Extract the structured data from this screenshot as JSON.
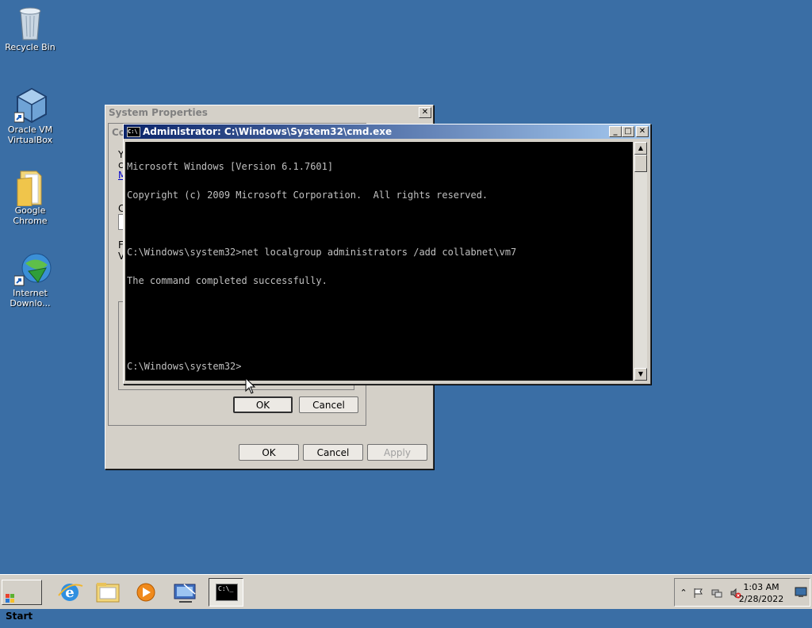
{
  "desktop": {
    "icons": [
      {
        "label": "Recycle Bin",
        "icon": "recycle-bin-icon"
      },
      {
        "label": "Oracle VM VirtualBox",
        "icon": "virtualbox-icon"
      },
      {
        "label": "Google Chrome",
        "icon": "folder-icon"
      },
      {
        "label": "Internet Downlo...",
        "icon": "internet-download-manager-icon"
      }
    ]
  },
  "system_properties": {
    "title": "System Properties",
    "close": "✕",
    "tab_fragment": "Co",
    "left_fragments": [
      "Y",
      "c",
      "M",
      "C",
      "F",
      "V"
    ],
    "ok_label": "OK",
    "cancel_label": "Cancel",
    "apply_label": "Apply"
  },
  "inner_dialog": {
    "ok_label": "OK",
    "cancel_label": "Cancel"
  },
  "cmd": {
    "title": "Administrator: C:\\Windows\\System32\\cmd.exe",
    "icon_text": "C:\\",
    "lines": [
      "Microsoft Windows [Version 6.1.7601]",
      "Copyright (c) 2009 Microsoft Corporation.  All rights reserved.",
      "",
      "C:\\Windows\\system32>net localgroup administrators /add collabnet\\vm7",
      "The command completed successfully.",
      "",
      "",
      "C:\\Windows\\system32>"
    ],
    "minimize": "_",
    "maximize": "□",
    "close": "✕"
  },
  "taskbar": {
    "start_label": "Start",
    "items": [
      "internet-explorer-icon",
      "windows-explorer-icon",
      "media-player-icon",
      "network-icon",
      "cmd-icon"
    ],
    "cmd_icon_text": "C:\\_",
    "tray": {
      "time": "1:03 AM",
      "date": "2/28/2022",
      "icons": [
        "show-hidden-icons-chevron",
        "action-center-flag-icon",
        "network-tray-icon",
        "volume-muted-icon"
      ]
    }
  },
  "colors": {
    "desktop": "#3a6ea5",
    "window_face": "#d4d0c8",
    "titlebar_active": "#0a246a",
    "console_bg": "#000000",
    "console_fg": "#c0c0c0"
  }
}
